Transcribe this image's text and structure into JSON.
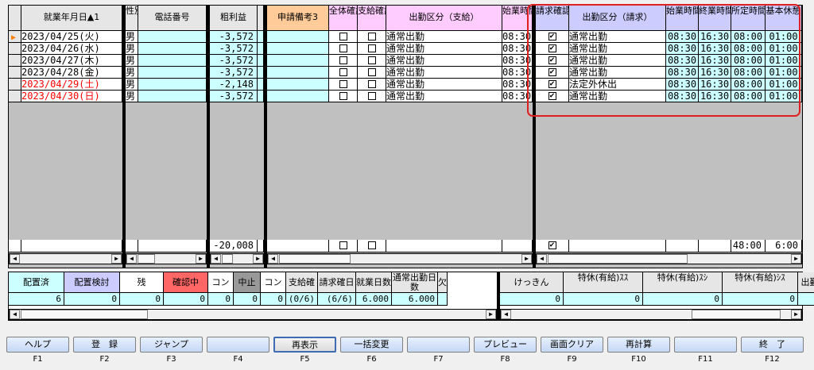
{
  "grid": {
    "headers": {
      "date": "就業年月日▲1",
      "gender": "性別",
      "phone": "電話番号",
      "profit": "粗利益",
      "memo3": "申請備考3",
      "overall_confirm": "全体確認",
      "pay_confirm": "支給確認",
      "attend_pay": "出勤区分（支給）",
      "start_time1": "始業時間",
      "bill_confirm": "請求確認",
      "attend_bill": "出勤区分（請求）",
      "start_time2": "始業時間",
      "end_time": "終業時間",
      "std_time": "所定時間",
      "break_time": "基本休憩"
    },
    "rows": [
      {
        "date": "2023/04/25(火)",
        "gender": "男",
        "profit": "-3,572",
        "attend_pay": "通常出勤",
        "start1": "08:30",
        "bill_checked": "✔",
        "attend_bill": "通常出勤",
        "start2": "08:30",
        "end": "16:30",
        "std": "08:00",
        "brk": "01:00"
      },
      {
        "date": "2023/04/26(水)",
        "gender": "男",
        "profit": "-3,572",
        "attend_pay": "通常出勤",
        "start1": "08:30",
        "bill_checked": "✔",
        "attend_bill": "通常出勤",
        "start2": "08:30",
        "end": "16:30",
        "std": "08:00",
        "brk": "01:00"
      },
      {
        "date": "2023/04/27(木)",
        "gender": "男",
        "profit": "-3,572",
        "attend_pay": "通常出勤",
        "start1": "08:30",
        "bill_checked": "✔",
        "attend_bill": "通常出勤",
        "start2": "08:30",
        "end": "16:30",
        "std": "08:00",
        "brk": "01:00"
      },
      {
        "date": "2023/04/28(金)",
        "gender": "男",
        "profit": "-3,572",
        "attend_pay": "通常出勤",
        "start1": "08:30",
        "bill_checked": "✔",
        "attend_bill": "通常出勤",
        "start2": "08:30",
        "end": "16:30",
        "std": "08:00",
        "brk": "01:00"
      },
      {
        "date": "2023/04/29(土)",
        "gender": "男",
        "profit": "-2,148",
        "attend_pay": "通常出勤",
        "start1": "08:30",
        "bill_checked": "✔",
        "attend_bill": "法定外休出",
        "start2": "08:30",
        "end": "16:30",
        "std": "08:00",
        "brk": "01:00"
      },
      {
        "date": "2023/04/30(日)",
        "gender": "男",
        "profit": "-3,572",
        "attend_pay": "通常出勤",
        "start1": "08:30",
        "bill_checked": "✔",
        "attend_bill": "通常出勤",
        "start2": "08:30",
        "end": "16:30",
        "std": "08:00",
        "brk": "01:00"
      }
    ],
    "totals": {
      "profit": "-20,008",
      "bill_checked": "✔",
      "std": "48:00",
      "brk": "6:00"
    }
  },
  "summary": {
    "headers": [
      "配置済",
      "配置検討",
      "残",
      "確認中",
      "コンプラ",
      "中止",
      "コンプラ",
      "支給確認",
      "請求確日",
      "就業日数",
      "通常出勤日数",
      "欠勤日数",
      "けっきん",
      "特休(有給)ｽｽ",
      "特休(有給)ｽｼ",
      "特休(有給)ｼｽ",
      "出勤区分"
    ],
    "values": [
      "6",
      "0",
      "0",
      "0",
      "0",
      "0",
      "0",
      "(0/6)",
      "(6/6)",
      "6.000",
      "6.000",
      "",
      "0",
      "0",
      "0",
      "0",
      ""
    ],
    "colors": [
      "#ccffff",
      "#ccccff",
      "#ffffff",
      "#ff6666",
      "#ffffff",
      "#999999",
      "#ffffff"
    ]
  },
  "fkeys": [
    {
      "label": "ヘルプ",
      "key": "F1"
    },
    {
      "label": "登　録",
      "key": "F2"
    },
    {
      "label": "ジャンプ",
      "key": "F3"
    },
    {
      "label": "",
      "key": "F4"
    },
    {
      "label": "再表示",
      "key": "F5"
    },
    {
      "label": "一括変更",
      "key": "F6"
    },
    {
      "label": "",
      "key": "F7"
    },
    {
      "label": "プレビュー",
      "key": "F8"
    },
    {
      "label": "画面クリア",
      "key": "F9"
    },
    {
      "label": "再計算",
      "key": "F10"
    },
    {
      "label": "",
      "key": "F11"
    },
    {
      "label": "終　了",
      "key": "F12"
    }
  ],
  "icons": {
    "current_row": "row-pointer-icon",
    "scroll_left": "scroll-left-icon",
    "scroll_right": "scroll-right-icon"
  },
  "accent": {
    "highlight": "#e02020",
    "row_marker": "#ff8000"
  }
}
